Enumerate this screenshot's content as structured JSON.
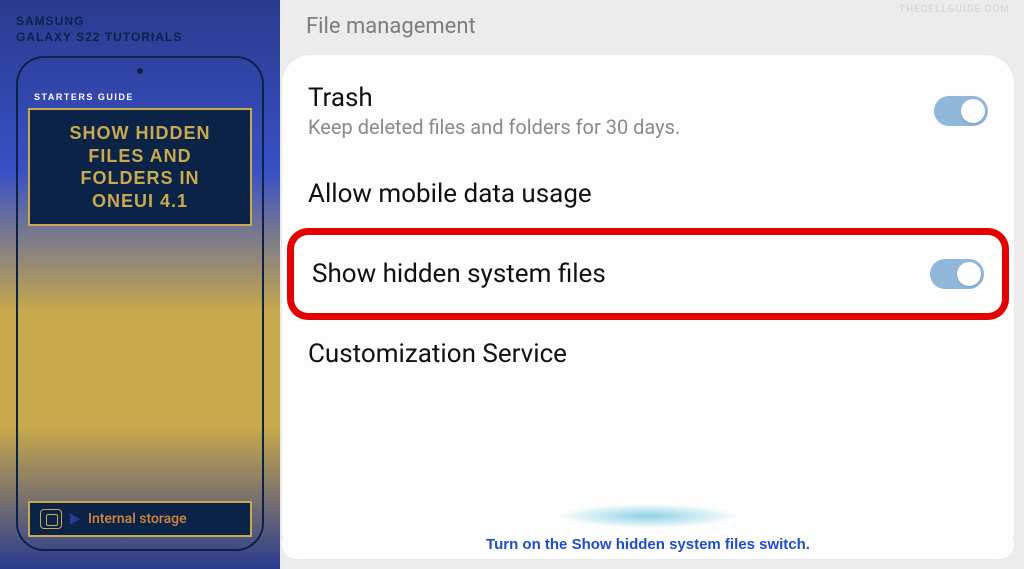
{
  "banner": {
    "brand_line1": "SAMSUNG",
    "brand_line2": "GALAXY S22 TUTORIALS",
    "guide_label": "STARTERS GUIDE",
    "title_line1": "SHOW HIDDEN",
    "title_line2": "FILES AND",
    "title_line3": "FOLDERS IN",
    "title_line4": "ONEUI 4.1",
    "storage_label": "Internal storage"
  },
  "settings": {
    "watermark": "THECELLGUIDE.COM",
    "section_header": "File management",
    "items": [
      {
        "title": "Trash",
        "subtitle": "Keep deleted files and folders for 30 days.",
        "has_toggle": true,
        "toggle_on": true
      },
      {
        "title": "Allow mobile data usage",
        "has_toggle": false
      },
      {
        "title": "Show hidden system files",
        "has_toggle": true,
        "toggle_on": true,
        "highlighted": true
      },
      {
        "title": "Customization Service",
        "has_toggle": false
      }
    ],
    "caption": "Turn on the Show hidden system files switch."
  }
}
